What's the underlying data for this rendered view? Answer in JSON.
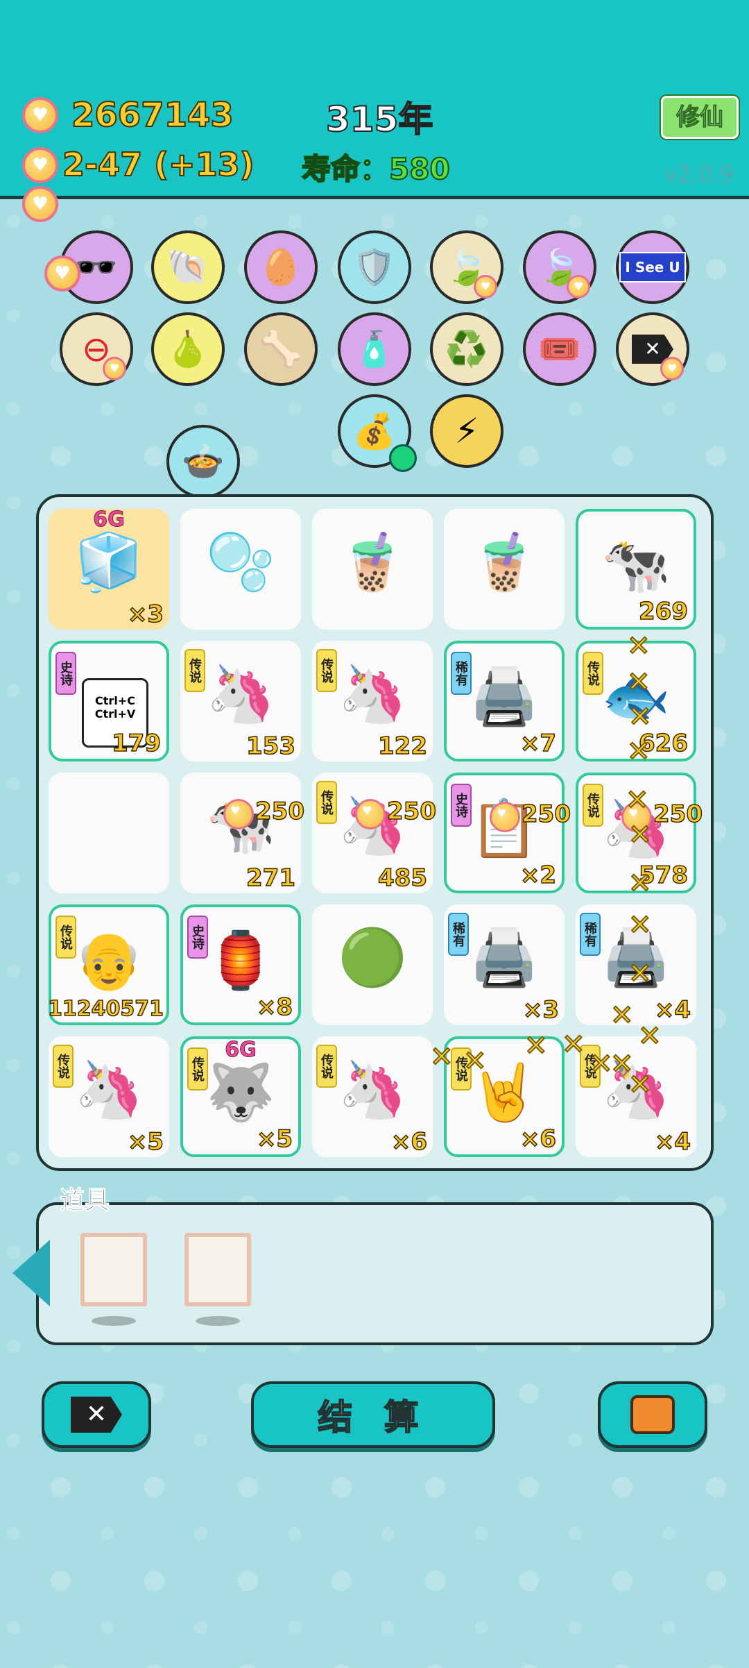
{
  "header": {
    "coins": "2667143",
    "rate": "2-47",
    "rate_bonus": "(+13)",
    "year": "315年",
    "lifespan": "寿命：580",
    "cultivate_button": "修仙",
    "version": "v2.0.9"
  },
  "board_cells": [
    {
      "count": "×3",
      "sixg": "6G"
    },
    {
      "count": ""
    },
    {
      "count": ""
    },
    {
      "count": ""
    },
    {
      "count": "269"
    },
    {
      "tag": "史诗",
      "count": "179",
      "text": "Ctrl+C Ctrl+V"
    },
    {
      "tag": "传说",
      "count": "153"
    },
    {
      "tag": "传说",
      "count": "122"
    },
    {
      "tag": "稀有",
      "count": "×7"
    },
    {
      "tag": "传说",
      "count": "626"
    },
    {
      "count": ""
    },
    {
      "count": "271",
      "price": "250"
    },
    {
      "tag": "传说",
      "count": "485",
      "price": "250"
    },
    {
      "tag": "史诗",
      "count": "×2",
      "price": "250"
    },
    {
      "tag": "传说",
      "count": "578",
      "price": "250"
    },
    {
      "tag": "传说",
      "count": "11240571"
    },
    {
      "tag": "史诗",
      "count": "×8"
    },
    {
      "count": ""
    },
    {
      "tag": "稀有",
      "count": "×3"
    },
    {
      "tag": "稀有",
      "count": "×4"
    },
    {
      "tag": "传说",
      "count": "×5"
    },
    {
      "tag": "传说",
      "count": "×5",
      "sixg": "6G"
    },
    {
      "tag": "传说",
      "count": "×6"
    },
    {
      "tag": "传说",
      "count": "×6"
    },
    {
      "tag": "传说",
      "count": "×4"
    }
  ],
  "tools": {
    "label": "道具"
  },
  "buttons": {
    "settle": "结 算"
  },
  "round_items_text": {
    "i_see_u": "I See U"
  }
}
